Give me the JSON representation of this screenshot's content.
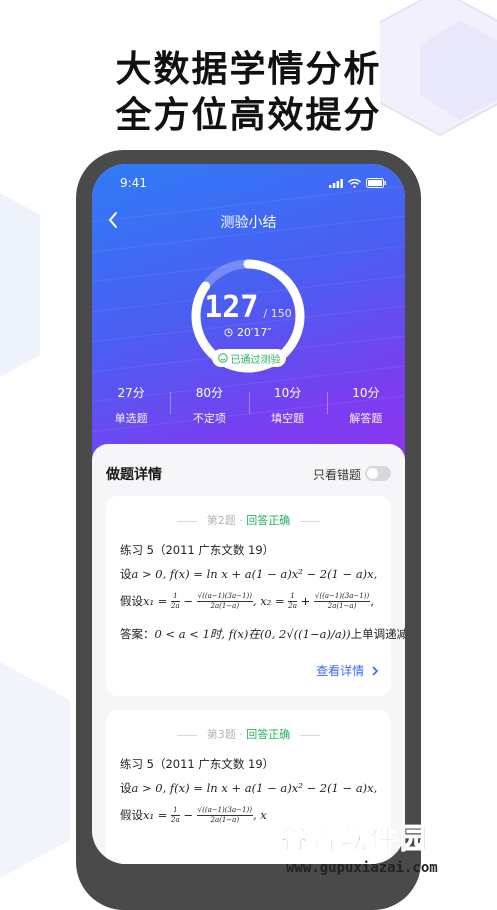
{
  "headline": {
    "line1": "大数据学情分析",
    "line2": "全方位高效提分"
  },
  "status_bar": {
    "time": "9:41"
  },
  "nav": {
    "title": "测验小结"
  },
  "score": {
    "value": "127",
    "total": "/ 150",
    "progress": 0.847,
    "time_used": "20′17″",
    "badge": "已通过测验"
  },
  "stats": [
    {
      "value": "27分",
      "label": "单选题"
    },
    {
      "value": "80分",
      "label": "不定项"
    },
    {
      "value": "10分",
      "label": "填空题"
    },
    {
      "value": "10分",
      "label": "解答题"
    }
  ],
  "details": {
    "title": "做题详情",
    "only_wrong_label": "只看错题",
    "only_wrong_on": false
  },
  "questions": [
    {
      "number": "第2题",
      "separator": "·",
      "result": "回答正确",
      "source": "练习 5（2011 广东文数 19）",
      "line_setup_prefix": "设",
      "line_setup_math": "a > 0,  f(x) = ln x + a(1 − a)x² − 2(1 − a)x,",
      "line_assume_prefix": "假设",
      "x1_lhs": "x₁ = ",
      "frac_a_num": "1",
      "frac_a_den": "2a",
      "minus": " − ",
      "frac_b_num": "√((a−1)(3a−1))",
      "frac_b_den": "2a(1−a)",
      "x2_lhs": ",  x₂ = ",
      "plus": " + ",
      "tail": ",",
      "answer_prefix": "答案：",
      "answer_cond": "0 < a < 1时,  f(x)在",
      "answer_interval": "(0, 2√((1−a)/a))",
      "answer_suffix": "上单调递减,",
      "detail_link": "查看详情"
    },
    {
      "number": "第3题",
      "separator": "·",
      "result": "回答正确",
      "source": "练习 5（2011 广东文数 19）",
      "line_setup_prefix": "设",
      "line_setup_math": "a > 0,  f(x) = ln x + a(1 − a)x² − 2(1 − a)x,",
      "line_assume_prefix": "假设",
      "x1_lhs": "x₁ = ",
      "frac_a_num": "1",
      "frac_a_den": "2a",
      "minus": " − ",
      "frac_b_num": "√((a−1)(3a−1))",
      "frac_b_den": "2a(1−a)",
      "x2_lhs": ",  x"
    }
  ],
  "watermark": {
    "title": "谷普软件园",
    "url": "www.gupuxiazai.com"
  },
  "colors": {
    "hero_start": "#2f7cf6",
    "hero_end": "#8d35ee",
    "correct": "#22b45a",
    "link": "#3b6cf0"
  }
}
